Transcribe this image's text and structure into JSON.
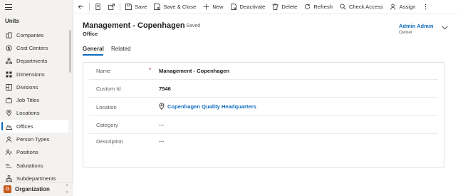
{
  "sidebar": {
    "group_title": "Units",
    "items": [
      {
        "label": "Companies",
        "icon": "companies-icon"
      },
      {
        "label": "Cost Centers",
        "icon": "cost-centers-icon"
      },
      {
        "label": "Departments",
        "icon": "departments-icon"
      },
      {
        "label": "Dimensions",
        "icon": "dimensions-icon"
      },
      {
        "label": "Divisions",
        "icon": "divisions-icon"
      },
      {
        "label": "Job Titles",
        "icon": "job-titles-icon"
      },
      {
        "label": "Locations",
        "icon": "locations-icon"
      },
      {
        "label": "Offices",
        "icon": "offices-icon",
        "active": true
      },
      {
        "label": "Person Types",
        "icon": "person-types-icon"
      },
      {
        "label": "Positions",
        "icon": "positions-icon"
      },
      {
        "label": "Salutations",
        "icon": "salutations-icon"
      },
      {
        "label": "Subdepartments",
        "icon": "subdepartments-icon"
      }
    ],
    "area": {
      "badge": "O",
      "label": "Organization"
    }
  },
  "toolbar": {
    "save": "Save",
    "save_close": "Save & Close",
    "new": "New",
    "deactivate": "Deactivate",
    "delete": "Delete",
    "refresh": "Refresh",
    "check_access": "Check Access",
    "assign": "Assign"
  },
  "record": {
    "title": "Management - Copenhagen",
    "status": "- Saved",
    "entity": "Office",
    "owner_name": "Admin Admin",
    "owner_label": "Owner"
  },
  "tabs": [
    {
      "label": "General",
      "active": true
    },
    {
      "label": "Related",
      "active": false
    }
  ],
  "form": {
    "name": {
      "label": "Name",
      "required": "*",
      "value": "Management - Copenhagen"
    },
    "custom_id": {
      "label": "Custom Id",
      "value": "7546"
    },
    "location": {
      "label": "Location",
      "value": "Copenhagen Quality Headquarters"
    },
    "category": {
      "label": "Category",
      "value": "---"
    },
    "description": {
      "label": "Description",
      "value": "---"
    }
  },
  "colors": {
    "accent": "#0f6cbd",
    "area_badge": "#c85a1d",
    "required": "#a4262c"
  }
}
